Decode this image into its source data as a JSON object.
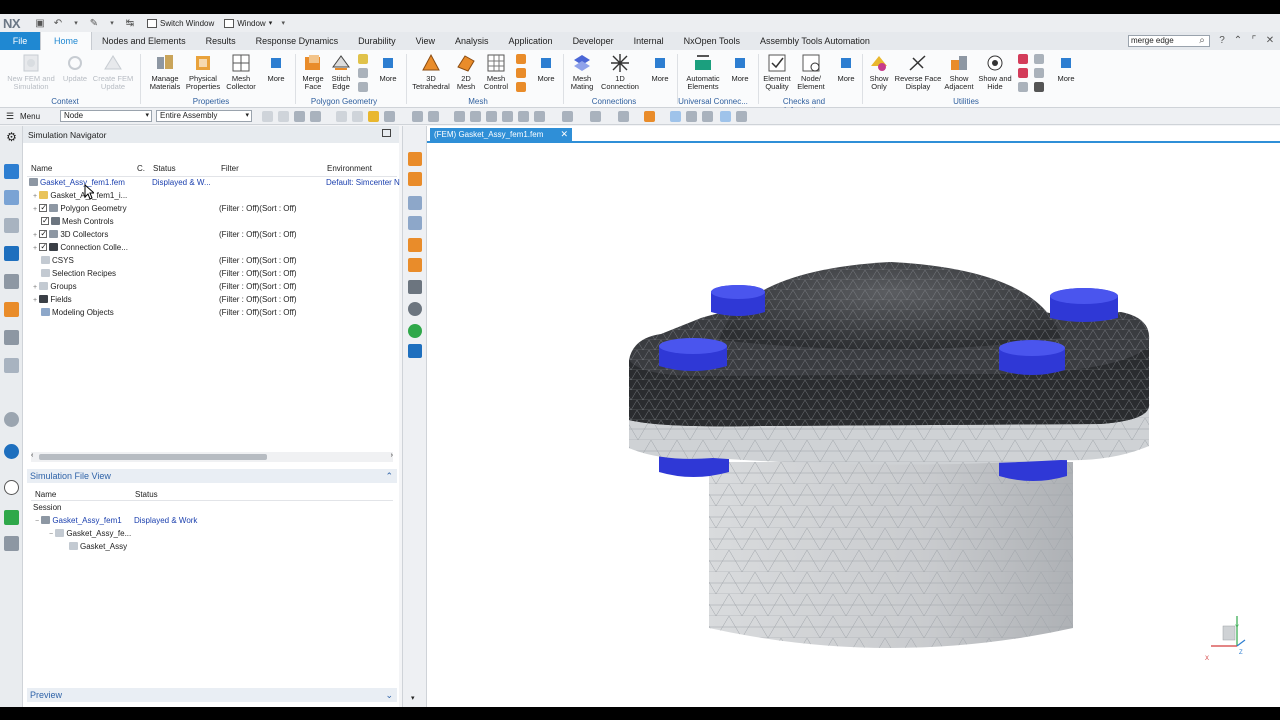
{
  "app": {
    "logo": "NX",
    "switch_window": "Switch Window",
    "window_menu": "Window"
  },
  "ribbon_tabs": [
    "File",
    "Home",
    "Nodes and Elements",
    "Results",
    "Response Dynamics",
    "Durability",
    "View",
    "Analysis",
    "Application",
    "Developer",
    "Internal",
    "NxOpen Tools",
    "Assembly Tools Automation"
  ],
  "active_tab": "Home",
  "command_search": {
    "value": "merge edge"
  },
  "ribbon": {
    "context": {
      "label": "Context",
      "buttons": [
        "New FEM and Simulation",
        "Update",
        "Create FEM Update"
      ]
    },
    "properties": {
      "label": "Properties",
      "buttons": [
        "Manage Materials",
        "Physical Properties",
        "Mesh Collector",
        "More"
      ]
    },
    "polygon_geometry": {
      "label": "Polygon Geometry",
      "buttons": [
        "Merge Face",
        "Stitch Edge",
        "More"
      ]
    },
    "mesh": {
      "label": "Mesh",
      "buttons": [
        "3D Tetrahedral",
        "2D Mesh",
        "Mesh Control",
        "More"
      ]
    },
    "connections": {
      "label": "Connections",
      "buttons": [
        "Mesh Mating",
        "1D Connection",
        "More"
      ]
    },
    "universal": {
      "label": "Universal Connec...",
      "buttons": [
        "Automatic Elements",
        "More"
      ]
    },
    "checks": {
      "label": "Checks and Information",
      "buttons": [
        "Element Quality",
        "Node/ Element",
        "More"
      ]
    },
    "utilities": {
      "label": "Utilities",
      "buttons": [
        "Show Only",
        "Reverse Face Display",
        "Show Adjacent",
        "Show and Hide",
        "More"
      ]
    }
  },
  "selection_bar": {
    "menu": "Menu",
    "filter": "Node",
    "scope": "Entire Assembly"
  },
  "navigator": {
    "title": "Simulation Navigator",
    "columns": [
      "Name",
      "C.",
      "Status",
      "Filter",
      "Environment"
    ],
    "rows": [
      {
        "name": "Gasket_Assy_fem1.fem",
        "status": "Displayed & W...",
        "filter": "",
        "env": "Default: Simcenter N"
      },
      {
        "name": "Gasket_A_ _fem1_i...",
        "status": "",
        "filter": "",
        "env": ""
      },
      {
        "name": "Polygon Geometry",
        "status": "",
        "filter": "(Filter : Off)(Sort : Off)",
        "env": ""
      },
      {
        "name": "Mesh Controls",
        "status": "",
        "filter": "",
        "env": ""
      },
      {
        "name": "3D Collectors",
        "status": "",
        "filter": "(Filter : Off)(Sort : Off)",
        "env": ""
      },
      {
        "name": "Connection Colle...",
        "status": "",
        "filter": "",
        "env": ""
      },
      {
        "name": "CSYS",
        "status": "",
        "filter": "(Filter : Off)(Sort : Off)",
        "env": ""
      },
      {
        "name": "Selection Recipes",
        "status": "",
        "filter": "(Filter : Off)(Sort : Off)",
        "env": ""
      },
      {
        "name": "Groups",
        "status": "",
        "filter": "(Filter : Off)(Sort : Off)",
        "env": ""
      },
      {
        "name": "Fields",
        "status": "",
        "filter": "(Filter : Off)(Sort : Off)",
        "env": ""
      },
      {
        "name": "Modeling Objects",
        "status": "",
        "filter": "(Filter : Off)(Sort : Off)",
        "env": ""
      }
    ]
  },
  "file_view": {
    "title": "Simulation File View",
    "columns": [
      "Name",
      "Status"
    ],
    "session": "Session",
    "rows": [
      {
        "name": "Gasket_Assy_fem1",
        "status": "Displayed & Work"
      },
      {
        "name": "Gasket_Assy_fe...",
        "status": ""
      },
      {
        "name": "Gasket_Assy",
        "status": ""
      }
    ]
  },
  "preview": {
    "title": "Preview"
  },
  "graphics": {
    "tab_label": "(FEM) Gasket_Assy_fem1.fem",
    "colors": {
      "body": "#4a4c50",
      "gasket": "#cdd0d3",
      "pipe": "#d8dadc",
      "bolt": "#2f38d6"
    }
  }
}
